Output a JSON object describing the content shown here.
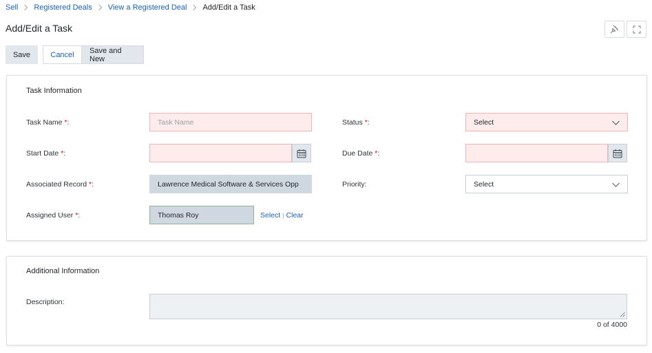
{
  "breadcrumb": {
    "items": [
      "Sell",
      "Registered Deals",
      "View a Registered Deal"
    ],
    "current": "Add/Edit a Task"
  },
  "page": {
    "title": "Add/Edit a Task",
    "icons": [
      "pin-icon",
      "expand-icon"
    ]
  },
  "toolbar": {
    "save_label": "Save",
    "cancel_label": "Cancel",
    "save_new_label": "Save and New"
  },
  "task_info": {
    "title": "Task Information",
    "required_marker": "*",
    "task_name": {
      "label": "Task Name ",
      "suffix": ":",
      "placeholder": "Task Name",
      "value": ""
    },
    "status": {
      "label": "Status ",
      "suffix": ":",
      "value": "Select"
    },
    "start_date": {
      "label": "Start Date ",
      "suffix": ":",
      "value": ""
    },
    "due_date": {
      "label": "Due Date ",
      "suffix": ":",
      "value": ""
    },
    "associated_record": {
      "label": "Associated Record  ",
      "suffix": ":",
      "value": "Lawrence Medical Software & Services Opp"
    },
    "priority": {
      "label": "Priority:",
      "value": "Select"
    },
    "assigned_user": {
      "label": "Assigned User ",
      "suffix": ":",
      "value": "Thomas Roy",
      "select_link": "Select",
      "separator": "|",
      "clear_link": "Clear"
    }
  },
  "additional_info": {
    "title": "Additional Information",
    "description": {
      "label": "Description:",
      "value": ""
    },
    "char_count": "0 of 4000"
  },
  "colors": {
    "link": "#1a5fb4",
    "required": "#c0151c",
    "error_bg": "#fdeceb",
    "error_border": "#f0b4b4",
    "readonly_bg": "#cfd8e1",
    "button_bg": "#e2e7ed"
  }
}
